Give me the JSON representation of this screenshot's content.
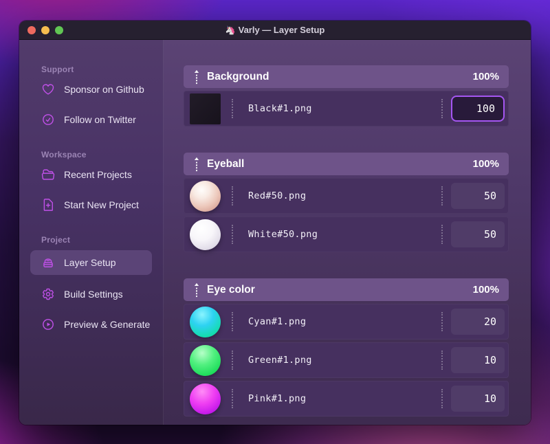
{
  "window": {
    "title": "Varly — Layer Setup",
    "app_icon": "🦄"
  },
  "sidebar": {
    "sections": [
      {
        "label": "Support",
        "items": [
          {
            "label": "Sponsor on Github",
            "icon": "heart-icon"
          },
          {
            "label": "Follow on Twitter",
            "icon": "check-badge-icon"
          }
        ]
      },
      {
        "label": "Workspace",
        "items": [
          {
            "label": "Recent Projects",
            "icon": "folder-open-icon"
          },
          {
            "label": "Start New Project",
            "icon": "document-plus-icon"
          }
        ]
      },
      {
        "label": "Project",
        "items": [
          {
            "label": "Layer Setup",
            "icon": "archive-box-icon",
            "active": true
          },
          {
            "label": "Build Settings",
            "icon": "gear-icon"
          },
          {
            "label": "Preview & Generate",
            "icon": "play-circle-icon"
          }
        ]
      }
    ]
  },
  "layers": {
    "groups": [
      {
        "name": "Background",
        "weight": "100%",
        "rows": [
          {
            "file": "Black#1.png",
            "value": "100",
            "thumb": "black",
            "focused": true
          }
        ]
      },
      {
        "name": "Eyeball",
        "weight": "100%",
        "rows": [
          {
            "file": "Red#50.png",
            "value": "50",
            "thumb": "red"
          },
          {
            "file": "White#50.png",
            "value": "50",
            "thumb": "white"
          }
        ]
      },
      {
        "name": "Eye color",
        "weight": "100%",
        "rows": [
          {
            "file": "Cyan#1.png",
            "value": "20",
            "thumb": "cyan"
          },
          {
            "file": "Green#1.png",
            "value": "10",
            "thumb": "green"
          },
          {
            "file": "Pink#1.png",
            "value": "10",
            "thumb": "pink"
          }
        ]
      }
    ]
  },
  "colors": {
    "accent": "#c050e8",
    "focus_border": "#a556f2",
    "header_bg": "#6e5389",
    "row_bg": "#46305f",
    "traffic_red": "#ee6a5f",
    "traffic_yellow": "#f5bd4f",
    "traffic_green": "#61c554"
  }
}
